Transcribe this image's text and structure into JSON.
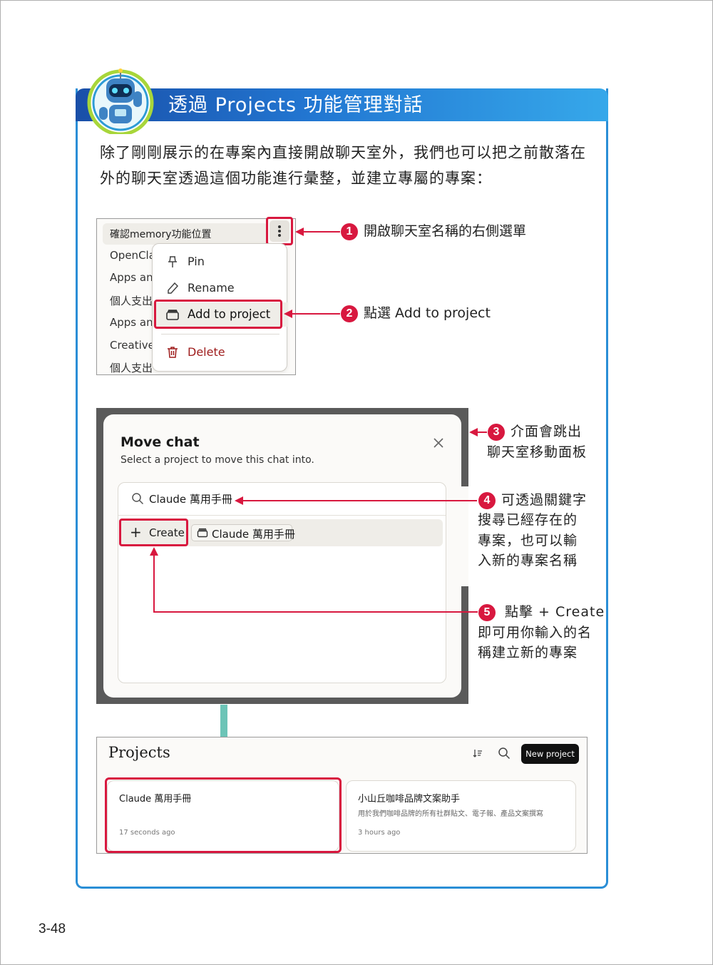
{
  "section": {
    "title": "透過 Projects 功能管理對話",
    "intro": "除了剛剛展示的在專案內直接開啟聊天室外，我們也可以把之前散落在外的聊天室透過這個功能進行彙整，並建立專屬的專案："
  },
  "sidebar": {
    "active_chat": "確認memory功能位置",
    "chats": [
      "OpenCla",
      "Apps an",
      "個人支出",
      "Apps an",
      "Creative",
      "個人支出"
    ]
  },
  "context_menu": {
    "items": [
      {
        "label": "Pin",
        "icon": "pin-icon"
      },
      {
        "label": "Rename",
        "icon": "pencil-icon"
      },
      {
        "label": "Add to project",
        "icon": "folder-stack-icon"
      },
      {
        "label": "Delete",
        "icon": "trash-icon"
      }
    ]
  },
  "move_dialog": {
    "title": "Move chat",
    "subtitle": "Select a project to move this chat into.",
    "search_value": "Claude 萬用手冊",
    "create_label": "Create",
    "project_chip": "Claude 萬用手冊"
  },
  "projects_page": {
    "title": "Projects",
    "new_project_label": "New project",
    "cards": [
      {
        "title": "Claude 萬用手冊",
        "description": "",
        "time": "17 seconds ago"
      },
      {
        "title": "小山丘咖啡品牌文案助手",
        "description": "用於我們咖啡品牌的所有社群貼文、電子報、產品文案撰寫",
        "time": "3 hours ago"
      }
    ]
  },
  "callouts": [
    {
      "num": "1",
      "lines": [
        "開啟聊天室名稱的右側選單"
      ]
    },
    {
      "num": "2",
      "lines": [
        "點選 Add to project"
      ]
    },
    {
      "num": "3",
      "lines": [
        "介面會跳出",
        "聊天室移動面板"
      ]
    },
    {
      "num": "4",
      "lines": [
        "可透過關鍵字",
        "搜尋已經存在的",
        "專案，也可以輸",
        "入新的專案名稱"
      ]
    },
    {
      "num": "5",
      "lines": [
        "點擊 + Create",
        "即可用你輸入的名",
        "稱建立新的專案"
      ]
    }
  ],
  "page_number": "3-48",
  "colors": {
    "accent": "#d8183f",
    "banner": "#2277d2",
    "arrow_teal": "#6cc4b7"
  }
}
